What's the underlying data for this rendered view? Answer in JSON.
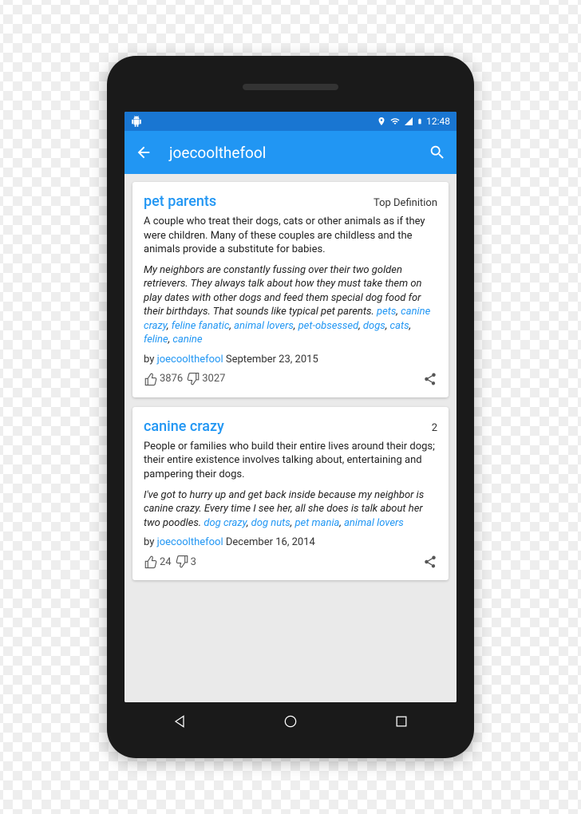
{
  "status": {
    "time": "12:48"
  },
  "appbar": {
    "title": "joecoolthefool"
  },
  "entries": [
    {
      "term": "pet parents",
      "rank": "Top Definition",
      "definition": "A couple who treat their dogs, cats or other animals as if they were children. Many of these couples are childless and the animals provide a substitute for babies.",
      "example_text": "My neighbors are constantly fussing over their two golden retrievers. They always talk about how they must take them on play dates with other dogs and feed them special dog food for their birthdays. That sounds like typical pet parents.",
      "tags": [
        "pets",
        "canine crazy",
        "feline fanatic",
        "animal lovers",
        "pet-obsessed",
        "dogs",
        "cats",
        "feline",
        "canine"
      ],
      "author": "joecoolthefool",
      "date": "September 23, 2015",
      "up": "3876",
      "down": "3027"
    },
    {
      "term": "canine crazy",
      "rank": "2",
      "definition": "People or families who build their entire lives around their dogs; their entire existence involves talking about, entertaining and pampering their dogs.",
      "example_text": "I've got to hurry up and get back inside because my neighbor is canine crazy. Every time I see her, all she does is talk about her two poodles.",
      "tags": [
        "dog crazy",
        "dog nuts",
        "pet mania",
        "animal lovers"
      ],
      "author": "joecoolthefool",
      "date": "December 16, 2014",
      "up": "24",
      "down": "3"
    }
  ],
  "labels": {
    "by": "by "
  }
}
